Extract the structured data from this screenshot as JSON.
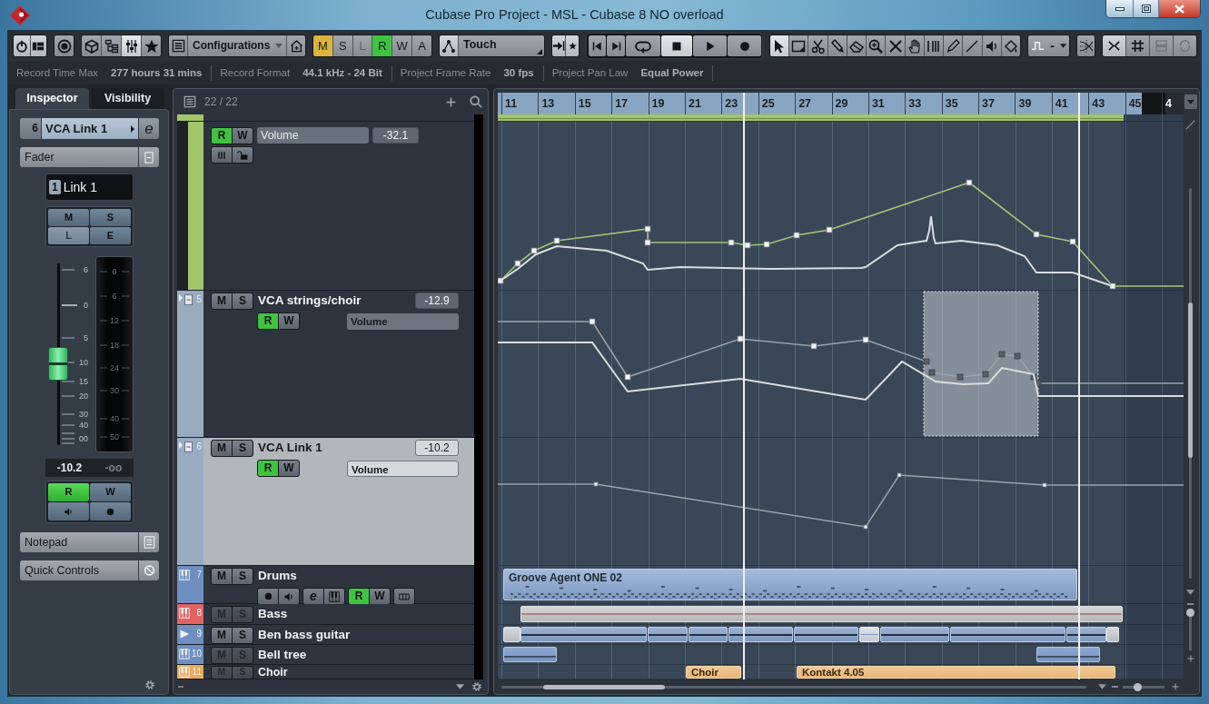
{
  "window": {
    "title": "Cubase Pro Project - MSL - Cubase 8 NO overload"
  },
  "toolbar": {
    "panels": [
      {
        "on": false
      },
      {
        "on": false
      },
      {
        "on": true
      },
      {
        "on": false
      }
    ],
    "configurations": "Configurations",
    "automation_buttons": [
      {
        "label": "M",
        "on": true,
        "color": "#dcb43c"
      },
      {
        "label": "S",
        "on": false
      },
      {
        "label": "L",
        "on": false
      },
      {
        "label": "R",
        "on": true,
        "color": "#3ec43e"
      },
      {
        "label": "W",
        "on": false
      },
      {
        "label": "A",
        "on": false
      }
    ],
    "automation_mode": "Touch",
    "transport": [
      {
        "kind": "previous",
        "on": false
      },
      {
        "kind": "next",
        "on": false
      },
      {
        "kind": "cycle",
        "on": false
      },
      {
        "kind": "stop",
        "on": true
      },
      {
        "kind": "play",
        "on": false
      },
      {
        "kind": "record",
        "on": false
      }
    ],
    "tools": [
      {
        "kind": "object",
        "selected": true
      },
      {
        "kind": "range",
        "selected": false
      },
      {
        "kind": "split",
        "selected": false
      },
      {
        "kind": "glue",
        "selected": false
      },
      {
        "kind": "erase",
        "selected": false
      },
      {
        "kind": "zoom",
        "selected": false
      },
      {
        "kind": "mute",
        "selected": false
      },
      {
        "kind": "comp",
        "selected": false
      },
      {
        "kind": "warp",
        "selected": false
      },
      {
        "kind": "draw",
        "selected": false
      },
      {
        "kind": "line",
        "selected": false
      },
      {
        "kind": "play",
        "selected": false
      },
      {
        "kind": "color",
        "selected": false
      }
    ],
    "quantize": "-"
  },
  "info_line": [
    {
      "label": "Record Time Max",
      "value": "277 hours 31 mins"
    },
    {
      "label": "Record Format",
      "value": "44.1 kHz - 24 Bit"
    },
    {
      "label": "Project Frame Rate",
      "value": "30 fps"
    },
    {
      "label": "Project Pan Law",
      "value": "Equal Power"
    }
  ],
  "inspector": {
    "tabs": [
      {
        "label": "Inspector",
        "selected": true
      },
      {
        "label": "Visibility",
        "selected": false
      }
    ],
    "track": {
      "number": "6",
      "name": "VCA Link 1",
      "edit_label": "e"
    },
    "fader": {
      "title": "Fader",
      "channel_number": "1",
      "channel_name": "Link 1",
      "buttons": [
        {
          "label": "M",
          "disabled": false
        },
        {
          "label": "S",
          "disabled": false
        },
        {
          "label": "L",
          "disabled": true
        },
        {
          "label": "E",
          "disabled": false
        }
      ],
      "scale": [
        "6",
        "0",
        "5",
        "10",
        "15",
        "20",
        "30",
        "40",
        "00"
      ],
      "meter_scale": [
        "0",
        "6",
        "12",
        "18",
        "24",
        "30",
        "40",
        "50"
      ],
      "level": 0.45,
      "volume": "-10.2",
      "peak": "-oo",
      "automation": [
        {
          "label": "R",
          "on": true
        },
        {
          "label": "W",
          "on": false
        }
      ]
    },
    "sections": [
      {
        "title": "Notepad"
      },
      {
        "title": "Quick Controls"
      }
    ]
  },
  "track_list": {
    "count": "22 / 22",
    "tracks": [
      {
        "kind": "automation",
        "color": "#a4c46c",
        "selected": false,
        "disabled": false,
        "buttons": [
          {
            "label": "R",
            "on": true
          },
          {
            "label": "W",
            "on": false
          }
        ],
        "parameter": "Volume",
        "value": "-32.1",
        "controls": [
          {
            "kind": "bars"
          },
          {
            "kind": "lock"
          }
        ]
      },
      {
        "kind": "vca",
        "number": "5",
        "name": "VCA strings/choir",
        "color": "#9aabbf",
        "selected": false,
        "disabled": false,
        "buttons": [
          {
            "label": "M",
            "on": false
          },
          {
            "label": "S",
            "on": false
          }
        ],
        "value": "-12.9",
        "automation": [
          {
            "label": "R",
            "on": true
          },
          {
            "label": "W",
            "on": false
          }
        ],
        "parameter": "Volume"
      },
      {
        "kind": "vca",
        "number": "6",
        "name": "VCA Link 1",
        "color": "#9aabbf",
        "selected": true,
        "disabled": false,
        "buttons": [
          {
            "label": "M",
            "on": false
          },
          {
            "label": "S",
            "on": false
          }
        ],
        "value": "-10.2",
        "automation": [
          {
            "label": "R",
            "on": true
          },
          {
            "label": "W",
            "on": false
          }
        ],
        "parameter": "Volume"
      },
      {
        "kind": "instrument",
        "number": "7",
        "name": "Drums",
        "color": "#6f8fc0",
        "selected": false,
        "disabled": false,
        "buttons": [
          {
            "label": "M",
            "on": false
          },
          {
            "label": "S",
            "on": false
          }
        ],
        "controls": [
          {
            "kind": "record"
          },
          {
            "kind": "monitor"
          },
          {
            "kind": "edit",
            "label": "e"
          },
          {
            "kind": "keys"
          },
          {
            "kind": "read",
            "label": "R",
            "on": true
          },
          {
            "kind": "write",
            "label": "W",
            "on": false
          },
          {
            "kind": "lanes"
          }
        ],
        "events": [
          {
            "name": "Groove Agent ONE 02"
          }
        ]
      },
      {
        "kind": "instrument",
        "number": "8",
        "name": "Bass",
        "color": "#e06464",
        "selected": false,
        "disabled": true,
        "buttons": [
          {
            "label": "M",
            "on": false
          },
          {
            "label": "S",
            "on": false
          }
        ]
      },
      {
        "kind": "audio",
        "number": "9",
        "name": "Ben bass guitar",
        "color": "#6f8fc0",
        "selected": false,
        "disabled": false,
        "buttons": [
          {
            "label": "M",
            "on": false
          },
          {
            "label": "S",
            "on": false
          }
        ]
      },
      {
        "kind": "instrument",
        "number": "10",
        "name": "Bell tree",
        "color": "#6f8fc0",
        "selected": false,
        "disabled": true,
        "buttons": [
          {
            "label": "M",
            "on": false
          },
          {
            "label": "S",
            "on": false
          }
        ]
      },
      {
        "kind": "instrument",
        "number": "11",
        "name": "Choir",
        "color": "#e8ac5c",
        "selected": false,
        "disabled": true,
        "buttons": [
          {
            "label": "M",
            "on": false
          },
          {
            "label": "S",
            "on": false
          }
        ],
        "events": [
          {
            "name": "Choir"
          },
          {
            "name": "Kontakt 4.05"
          }
        ]
      }
    ]
  },
  "arrangement": {
    "ruler": [
      "11",
      "13",
      "15",
      "17",
      "19",
      "21",
      "23",
      "25",
      "27",
      "29",
      "31",
      "33",
      "35",
      "37",
      "39",
      "41",
      "43",
      "45",
      "4"
    ],
    "horizontal_zoom": {
      "level": 0.39
    },
    "vertical_zoom": {
      "level": 0.16
    }
  }
}
